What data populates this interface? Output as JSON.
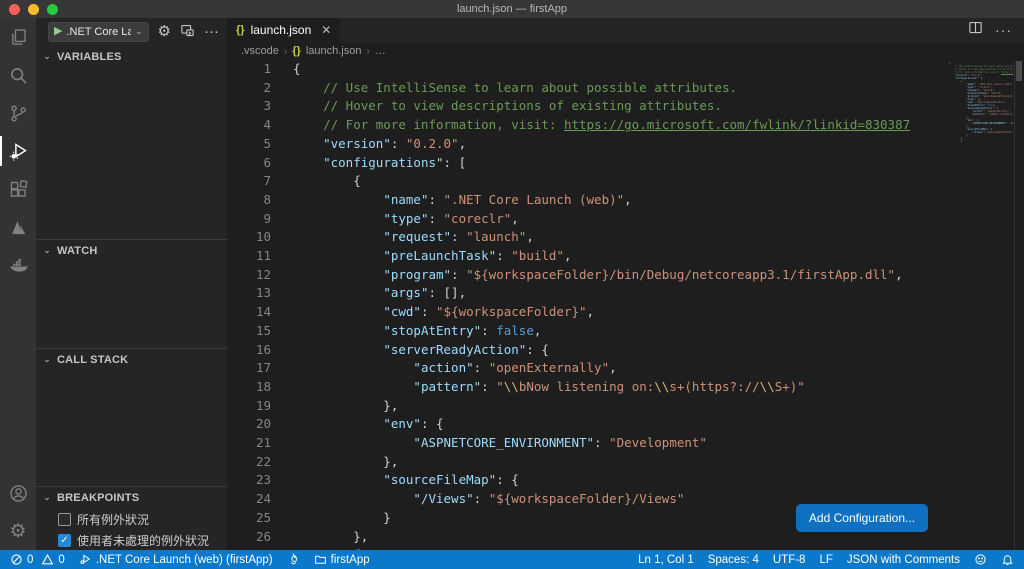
{
  "window": {
    "title": "launch.json — firstApp"
  },
  "colors": {
    "status_bar": "#0a79cc",
    "button": "#0e70c0",
    "accent_check": "#2488db",
    "traffic_red": "#ff5f57",
    "traffic_yellow": "#febc2e",
    "traffic_green": "#28c840",
    "comment": "#6a9955",
    "key": "#9cdcfe",
    "string": "#ce9178",
    "keyword": "#569cd6",
    "escape": "#d7ba7d"
  },
  "activity_bar": {
    "items": [
      "explorer",
      "search",
      "source-control",
      "run-and-debug",
      "extensions",
      "azure",
      "docker"
    ],
    "active": "run-and-debug",
    "bottom_items": [
      "account",
      "settings"
    ]
  },
  "debug_toolbar": {
    "config_label": ".NET Core Launc",
    "gear_glyph": "⚙",
    "more_label": "···"
  },
  "sidebar": {
    "sections": {
      "variables": "VARIABLES",
      "watch": "WATCH",
      "call_stack": "CALL STACK",
      "breakpoints": "BREAKPOINTS"
    },
    "breakpoint_items": [
      {
        "label": "所有例外狀況",
        "checked": false
      },
      {
        "label": "使用者未處理的例外狀況",
        "checked": true
      }
    ]
  },
  "editor": {
    "tab": {
      "icon": "{}",
      "label": "launch.json",
      "close": "✕"
    },
    "breadcrumb": {
      "folder": ".vscode",
      "braces": "{}",
      "file": "launch.json",
      "more": "…"
    },
    "add_configuration_label": "Add Configuration...",
    "lines": [
      [
        [
          "p",
          "{"
        ]
      ],
      [
        [
          "c",
          "    // Use IntelliSense to learn about possible attributes."
        ]
      ],
      [
        [
          "c",
          "    // Hover to view descriptions of existing attributes."
        ]
      ],
      [
        [
          "c",
          "    // For more information, visit: "
        ],
        [
          "l",
          "https://go.microsoft.com/fwlink/?linkid=830387"
        ]
      ],
      [
        [
          "p",
          "    "
        ],
        [
          "k",
          "\"version\""
        ],
        [
          "p",
          ": "
        ],
        [
          "s",
          "\"0.2.0\""
        ],
        [
          "p",
          ","
        ]
      ],
      [
        [
          "p",
          "    "
        ],
        [
          "k",
          "\"configurations\""
        ],
        [
          "p",
          ": ["
        ]
      ],
      [
        [
          "p",
          "        {"
        ]
      ],
      [
        [
          "p",
          "            "
        ],
        [
          "k",
          "\"name\""
        ],
        [
          "p",
          ": "
        ],
        [
          "s",
          "\".NET Core Launch (web)\""
        ],
        [
          "p",
          ","
        ]
      ],
      [
        [
          "p",
          "            "
        ],
        [
          "k",
          "\"type\""
        ],
        [
          "p",
          ": "
        ],
        [
          "s",
          "\"coreclr\""
        ],
        [
          "p",
          ","
        ]
      ],
      [
        [
          "p",
          "            "
        ],
        [
          "k",
          "\"request\""
        ],
        [
          "p",
          ": "
        ],
        [
          "s",
          "\"launch\""
        ],
        [
          "p",
          ","
        ]
      ],
      [
        [
          "p",
          "            "
        ],
        [
          "k",
          "\"preLaunchTask\""
        ],
        [
          "p",
          ": "
        ],
        [
          "s",
          "\"build\""
        ],
        [
          "p",
          ","
        ]
      ],
      [
        [
          "p",
          "            "
        ],
        [
          "k",
          "\"program\""
        ],
        [
          "p",
          ": "
        ],
        [
          "s",
          "\"${workspaceFolder}/bin/Debug/netcoreapp3.1/firstApp.dll\""
        ],
        [
          "p",
          ","
        ]
      ],
      [
        [
          "p",
          "            "
        ],
        [
          "k",
          "\"args\""
        ],
        [
          "p",
          ": [],"
        ]
      ],
      [
        [
          "p",
          "            "
        ],
        [
          "k",
          "\"cwd\""
        ],
        [
          "p",
          ": "
        ],
        [
          "s",
          "\"${workspaceFolder}\""
        ],
        [
          "p",
          ","
        ]
      ],
      [
        [
          "p",
          "            "
        ],
        [
          "k",
          "\"stopAtEntry\""
        ],
        [
          "p",
          ": "
        ],
        [
          "b",
          "false"
        ],
        [
          "p",
          ","
        ]
      ],
      [
        [
          "p",
          "            "
        ],
        [
          "k",
          "\"serverReadyAction\""
        ],
        [
          "p",
          ": {"
        ]
      ],
      [
        [
          "p",
          "                "
        ],
        [
          "k",
          "\"action\""
        ],
        [
          "p",
          ": "
        ],
        [
          "s",
          "\"openExternally\""
        ],
        [
          "p",
          ","
        ]
      ],
      [
        [
          "p",
          "                "
        ],
        [
          "k",
          "\"pattern\""
        ],
        [
          "p",
          ": "
        ],
        [
          "s",
          "\""
        ],
        [
          "e",
          "\\\\"
        ],
        [
          "s",
          "bNow listening on:"
        ],
        [
          "e",
          "\\\\"
        ],
        [
          "s",
          "s+(https?://"
        ],
        [
          "e",
          "\\\\"
        ],
        [
          "s",
          "S+)\""
        ]
      ],
      [
        [
          "p",
          "            },"
        ]
      ],
      [
        [
          "p",
          "            "
        ],
        [
          "k",
          "\"env\""
        ],
        [
          "p",
          ": {"
        ]
      ],
      [
        [
          "p",
          "                "
        ],
        [
          "k",
          "\"ASPNETCORE_ENVIRONMENT\""
        ],
        [
          "p",
          ": "
        ],
        [
          "s",
          "\"Development\""
        ]
      ],
      [
        [
          "p",
          "            },"
        ]
      ],
      [
        [
          "p",
          "            "
        ],
        [
          "k",
          "\"sourceFileMap\""
        ],
        [
          "p",
          ": {"
        ]
      ],
      [
        [
          "p",
          "                "
        ],
        [
          "k",
          "\"/Views\""
        ],
        [
          "p",
          ": "
        ],
        [
          "s",
          "\"${workspaceFolder}/Views\""
        ]
      ],
      [
        [
          "p",
          "            }"
        ]
      ],
      [
        [
          "p",
          "        },"
        ]
      ],
      [
        [
          "p",
          "        {"
        ]
      ]
    ]
  },
  "status_bar": {
    "errors": "0",
    "warnings": "0",
    "debug_target": ".NET Core Launch (web) (firstApp)",
    "workspace": "firstApp",
    "line_col": "Ln 1, Col 1",
    "spaces": "Spaces: 4",
    "encoding": "UTF-8",
    "eol": "LF",
    "language_mode": "JSON with Comments"
  }
}
